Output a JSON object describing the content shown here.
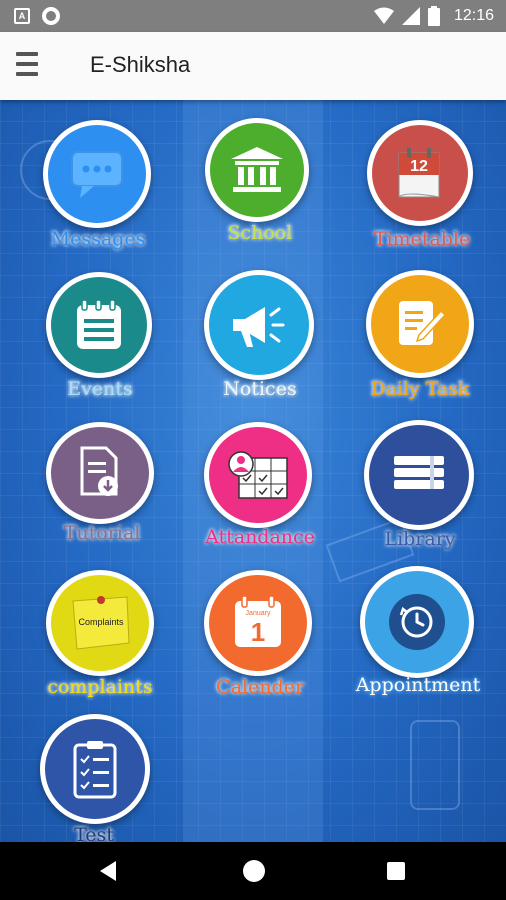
{
  "status_bar": {
    "time": "12:16",
    "left_icons": [
      "app-a-icon",
      "circle-icon"
    ],
    "right_icons": [
      "wifi-icon",
      "cell-signal-icon",
      "battery-icon"
    ]
  },
  "app_bar": {
    "title": "E-Shiksha",
    "menu_icon": "hamburger-icon"
  },
  "tiles": [
    {
      "label": "Messages",
      "icon": "chat-bubble-icon",
      "bg": "#2d8ff0",
      "color": "#ffffff"
    },
    {
      "label": "School",
      "icon": "school-building-icon",
      "bg": "#4cae2c",
      "color": "#d9f06a"
    },
    {
      "label": "Timetable",
      "icon": "calendar-12-icon",
      "bg": "#c9504a",
      "color": "#e05a55"
    },
    {
      "label": "Events",
      "icon": "notepad-icon",
      "bg": "#1b8a8a",
      "color": "#c8f0ff"
    },
    {
      "label": "Notices",
      "icon": "megaphone-icon",
      "bg": "#21a8e0",
      "color": "#ffffff"
    },
    {
      "label": "Daily Task",
      "icon": "task-pencil-icon",
      "bg": "#f0a616",
      "color": "#f0a616"
    },
    {
      "label": "Tutorial",
      "icon": "document-download-icon",
      "bg": "#7a5f86",
      "color": "#8a7090"
    },
    {
      "label": "Attandance",
      "icon": "attendance-grid-icon",
      "bg": "#ef2f86",
      "color": "#ef2f86"
    },
    {
      "label": "Library",
      "icon": "books-stack-icon",
      "bg": "#2d4f9c",
      "color": "#3a5aa8"
    },
    {
      "label": "complaints",
      "icon": "sticky-note-icon",
      "bg": "#e0d914",
      "color": "#e9df20"
    },
    {
      "label": "Calender",
      "icon": "calendar-january-1-icon",
      "bg": "#f26a2e",
      "color": "#f26a2e"
    },
    {
      "label": "Appointment",
      "icon": "clock-history-icon",
      "bg": "#3ba3e6",
      "color": "#ffffff"
    },
    {
      "label": "Test",
      "icon": "clipboard-checklist-icon",
      "bg": "#2f55a8",
      "color": "#1f3a7a"
    }
  ],
  "sticky_note_text": "Complaints",
  "calendar_tile": {
    "month": "January",
    "day": "1"
  },
  "timetable_tile": {
    "day": "12"
  },
  "nav_bar": {
    "icons": [
      "back-icon",
      "home-icon",
      "recent-apps-icon"
    ]
  }
}
